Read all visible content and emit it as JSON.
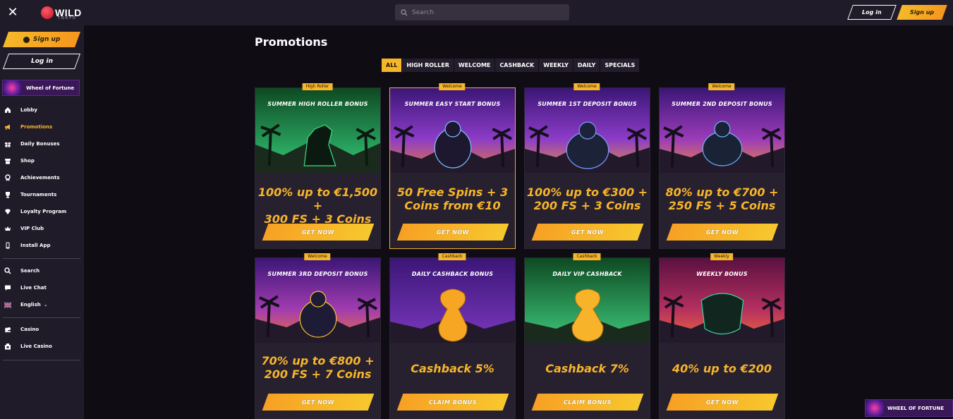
{
  "header": {
    "logo_word": "WILD",
    "logo_sub": "TOKYO",
    "search_placeholder": "Search",
    "login_label": "Log in",
    "signup_label": "Sign up"
  },
  "sidebar": {
    "signup_label": "Sign up",
    "login_label": "Log in",
    "wheel_label": "Wheel of Fortune",
    "items": [
      {
        "label": "Lobby",
        "icon": "home-icon"
      },
      {
        "label": "Promotions",
        "icon": "megaphone-icon",
        "active": true
      },
      {
        "label": "Daily Bonuses",
        "icon": "gift-icon"
      },
      {
        "label": "Shop",
        "icon": "shop-icon"
      },
      {
        "label": "Achievements",
        "icon": "medal-icon"
      },
      {
        "label": "Tournaments",
        "icon": "trophy-icon"
      },
      {
        "label": "Loyalty Program",
        "icon": "diamond-icon"
      },
      {
        "label": "VIP Club",
        "icon": "crown-icon"
      },
      {
        "label": "Install App",
        "icon": "phone-icon"
      }
    ],
    "items2": [
      {
        "label": "Search",
        "icon": "search-icon"
      },
      {
        "label": "Live Chat",
        "icon": "chat-icon"
      },
      {
        "label": "English",
        "icon": "uk-flag-icon"
      }
    ],
    "items3": [
      {
        "label": "Casino",
        "icon": "slots-icon"
      },
      {
        "label": "Live Casino",
        "icon": "live-casino-icon"
      }
    ]
  },
  "main": {
    "title": "Promotions",
    "filters": [
      "ALL",
      "HIGH ROLLER",
      "WELCOME",
      "CASHBACK",
      "WEEKLY",
      "DAILY",
      "SPECIALS"
    ],
    "cards": [
      {
        "tag": "High Roller",
        "title": "SUMMER HIGH ROLLER BONUS",
        "offer_lines": [
          "100% up to €1,500 +",
          "300 FS + 3 Coins"
        ],
        "cta": "GET NOW"
      },
      {
        "tag": "Welcome",
        "title": "SUMMER EASY START BONUS",
        "offer_lines": [
          "50 Free Spins + 3",
          "Coins from €10"
        ],
        "cta": "GET NOW"
      },
      {
        "tag": "Welcome",
        "title": "SUMMER 1ST DEPOSIT BONUS",
        "offer_lines": [
          "100% up to €300 +",
          "200 FS + 3 Coins"
        ],
        "cta": "GET NOW"
      },
      {
        "tag": "Welcome",
        "title": "SUMMER 2ND DEPOSIT BONUS",
        "offer_lines": [
          "80% up to €700 +",
          "250 FS + 5 Coins"
        ],
        "cta": "GET NOW"
      },
      {
        "tag": "Welcome",
        "title": "SUMMER 3RD DEPOSIT BONUS",
        "offer_lines": [
          "70% up to €800 +",
          "200 FS + 7 Coins"
        ],
        "cta": "GET NOW"
      },
      {
        "tag": "Cashback",
        "title": "DAILY CASHBACK BONUS",
        "offer_lines": [
          "Cashback 5%"
        ],
        "cta": "CLAIM BONUS"
      },
      {
        "tag": "Cashback",
        "title": "DAILY VIP CASHBACK",
        "offer_lines": [
          "Cashback 7%"
        ],
        "cta": "CLAIM BONUS"
      },
      {
        "tag": "Weekly",
        "title": "WEEKLY BONUS",
        "offer_lines": [
          "40% up to €200"
        ],
        "cta": "GET NOW"
      }
    ]
  },
  "floating": {
    "wheel_label": "WHEEL OF FORTUNE"
  },
  "colors": {
    "accent": "#f7b52a",
    "background": "#0f0c14",
    "panel": "#201b29"
  }
}
